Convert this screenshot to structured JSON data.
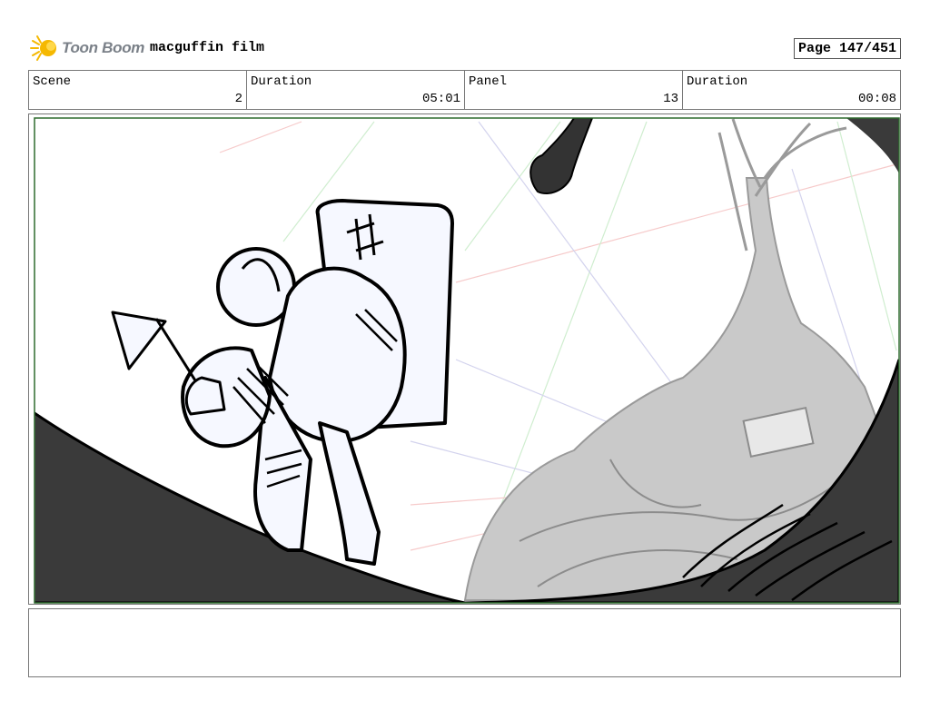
{
  "header": {
    "logo_text": "Toon Boom",
    "film_title": "macguffin film",
    "page_label": "Page 147/451"
  },
  "info": [
    {
      "label": "Scene",
      "value": "2"
    },
    {
      "label": "Duration",
      "value": "05:01"
    },
    {
      "label": "Panel",
      "value": "13"
    },
    {
      "label": "Duration",
      "value": "00:08"
    }
  ],
  "notes": ""
}
